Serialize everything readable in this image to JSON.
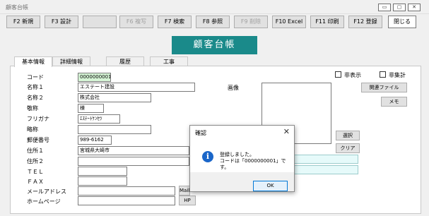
{
  "window": {
    "title": "顧客台帳",
    "min": "▭",
    "max": "▢",
    "close": "✕"
  },
  "fkeys": [
    "F2 新規",
    "F3 設計",
    "",
    "F6 複写",
    "F7 検索",
    "F8 参照",
    "F9 削除",
    "F10 Excel",
    "F11 印刷",
    "F12 登録"
  ],
  "close_button": "閉じる",
  "banner": "顧客台帳",
  "tabs": [
    "基本情報",
    "詳細情報",
    "履歴",
    "工事"
  ],
  "labels": {
    "code": "コード",
    "name1": "名称１",
    "name2": "名称２",
    "honorific": "敬称",
    "furigana": "フリガナ",
    "abbr": "略称",
    "postal": "郵便番号",
    "addr1": "住所１",
    "addr2": "住所２",
    "tel": "ＴＥＬ",
    "fax": "ＦＡＸ",
    "email": "メールアドレス",
    "homepage": "ホームページ",
    "image": "画像"
  },
  "values": {
    "code": "0000000001",
    "name1": "エステート建設",
    "name2": "株式会社",
    "honorific": "様",
    "furigana": "ｴｽﾃｰﾄｹﾝｾﾂ",
    "abbr": "",
    "postal": "989-6162",
    "addr1": "宮城県大崎市",
    "addr2": "",
    "tel": "",
    "fax": "",
    "email": "",
    "homepage": ""
  },
  "checkboxes": {
    "hidden": "非表示",
    "no_aggregate": "非集計"
  },
  "buttons": {
    "related_file": "関連ファイル",
    "memo": "メモ",
    "select": "選択",
    "clear": "クリア",
    "mail": "Mail",
    "hp": "HP"
  },
  "dialog": {
    "title": "確認",
    "line1": "登録しました。",
    "line2": "コードは「0000000001」です。",
    "ok": "OK",
    "close": "✕"
  }
}
